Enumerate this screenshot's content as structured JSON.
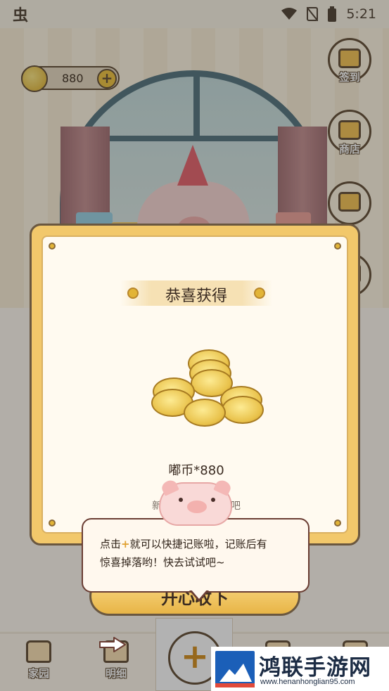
{
  "status_bar": {
    "time": "5:21",
    "app_glyph": "虫"
  },
  "header": {
    "coins": "880"
  },
  "side_menu": [
    {
      "label": "签到",
      "icon": "calendar-icon"
    },
    {
      "label": "商店",
      "icon": "shop-icon"
    }
  ],
  "bottom_nav": {
    "home_label": "家园",
    "detail_label": "明细",
    "add_glyph": "+"
  },
  "reward_modal": {
    "title": "恭喜获得",
    "amount": "嘟币*880",
    "note": "新用户登……收下吧",
    "confirm": "开心收下"
  },
  "tooltip": {
    "line1_a": "点击",
    "plus": "+",
    "line1_b": "就可以快捷记账啦，记账后有",
    "line2": "惊喜掉落哟！快去试试吧~"
  },
  "watermark": {
    "title": "鸿联手游网",
    "url": "www.henanhonglian95.com"
  },
  "colors": {
    "modal_frame": "#f2c86b",
    "outline": "#6a573f",
    "accent_plus": "#e0a02f"
  }
}
